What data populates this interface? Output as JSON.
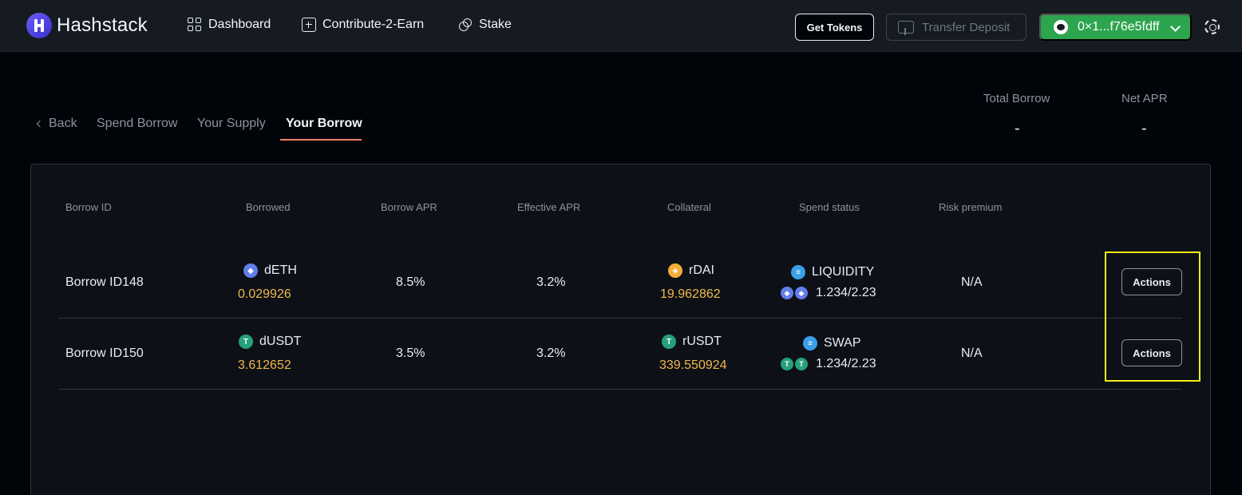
{
  "app": {
    "name": "Hashstack"
  },
  "nav": {
    "items": [
      {
        "label": "Dashboard",
        "icon": "grid-icon"
      },
      {
        "label": "Contribute-2-Earn",
        "icon": "plus-box-icon"
      },
      {
        "label": "Stake",
        "icon": "coins-icon"
      }
    ],
    "get_tokens": "Get Tokens",
    "transfer_deposit": "Transfer Deposit",
    "wallet_address": "0×1...f76e5fdff"
  },
  "tabs": {
    "back": "Back",
    "items": [
      "Spend Borrow",
      "Your Supply",
      "Your Borrow"
    ],
    "active": "Your Borrow"
  },
  "stats": {
    "total_borrow_label": "Total Borrow",
    "total_borrow_value": "-",
    "net_apr_label": "Net APR",
    "net_apr_value": "-"
  },
  "table": {
    "headers": [
      "Borrow ID",
      "Borrowed",
      "Borrow APR",
      "Effective APR",
      "Collateral",
      "Spend status",
      "Risk premium"
    ],
    "rows": [
      {
        "borrow_id": "Borrow ID148",
        "borrowed_token": "dETH",
        "borrowed_amount": "0.029926",
        "borrow_apr": "8.5%",
        "effective_apr": "3.2%",
        "collateral_token": "rDAI",
        "collateral_amount": "19.962862",
        "spend_status": "LIQUIDITY",
        "spend_ratio": "1.234/2.23",
        "risk_premium": "N/A",
        "action": "Actions"
      },
      {
        "borrow_id": "Borrow ID150",
        "borrowed_token": "dUSDT",
        "borrowed_amount": "3.612652",
        "borrow_apr": "3.5%",
        "effective_apr": "3.2%",
        "collateral_token": "rUSDT",
        "collateral_amount": "339.550924",
        "spend_status": "SWAP",
        "spend_ratio": "1.234/2.23",
        "risk_premium": "N/A",
        "action": "Actions"
      }
    ]
  },
  "colors": {
    "accent_green": "#2da44e",
    "amount_gold": "#f2b84b",
    "tab_underline": "#f78166",
    "highlight_box": "#f3ec19"
  }
}
